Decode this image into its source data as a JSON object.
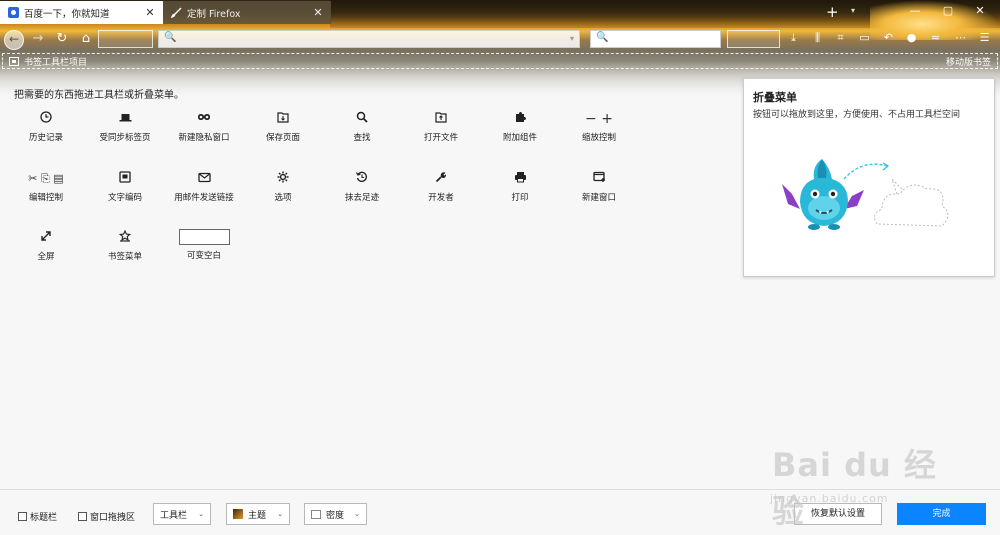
{
  "tabs": [
    {
      "title": "百度一下，你就知道",
      "icon": "baidu-paw-icon"
    },
    {
      "title": "定制 Firefox",
      "icon": "paintbrush-icon"
    }
  ],
  "tab_close_glyph": "✕",
  "new_tab_glyph": "+",
  "tab_list_glyph": "▾",
  "window_controls": {
    "minimize": "—",
    "maximize": "▢",
    "close": "✕"
  },
  "nav": {
    "back": "←",
    "forward": "→",
    "reload": "↻",
    "home": "⌂",
    "url_dropdown": "▾",
    "search_glyph": "🔍"
  },
  "toolbar_icons": [
    "⤓",
    "⫼",
    "⌗",
    "▭",
    "↶",
    "●",
    "≈",
    "⋯",
    "☰"
  ],
  "bookmarks_bar": {
    "left_label": "书签工具栏项目",
    "right_label": "移动版书签"
  },
  "customize": {
    "hint": "把需要的东西拖进工具栏或折叠菜单。",
    "items": [
      {
        "label": "历史记录",
        "icon": "history-clock-icon",
        "glyph": "🕓"
      },
      {
        "label": "受同步标签页",
        "icon": "synced-tabs-icon",
        "glyph": "▬"
      },
      {
        "label": "新建隐私窗口",
        "icon": "private-mask-icon",
        "glyph": "∞"
      },
      {
        "label": "保存页面",
        "icon": "save-page-icon",
        "glyph": "▣"
      },
      {
        "label": "查找",
        "icon": "find-magnifier-icon",
        "glyph": "⌕"
      },
      {
        "label": "打开文件",
        "icon": "open-file-icon",
        "glyph": "▤"
      },
      {
        "label": "附加组件",
        "icon": "addons-puzzle-icon",
        "glyph": "✚"
      },
      {
        "label": "缩放控制",
        "icon": "zoom-controls-icon",
        "glyph": "− +"
      },
      {
        "label": "编辑控制",
        "icon": "edit-controls-icon",
        "glyph": "✂ ⎘ ▤"
      },
      {
        "label": "文字编码",
        "icon": "text-encoding-icon",
        "glyph": "▣"
      },
      {
        "label": "用邮件发送链接",
        "icon": "email-link-icon",
        "glyph": "✉"
      },
      {
        "label": "选项",
        "icon": "options-gear-icon",
        "glyph": "✲"
      },
      {
        "label": "抹去足迹",
        "icon": "forget-history-icon",
        "glyph": "↺"
      },
      {
        "label": "开发者",
        "icon": "developer-wrench-icon",
        "glyph": "🔧"
      },
      {
        "label": "打印",
        "icon": "print-icon",
        "glyph": "⎙"
      },
      {
        "label": "新建窗口",
        "icon": "new-window-icon",
        "glyph": "▭"
      },
      {
        "label": "全屏",
        "icon": "fullscreen-icon",
        "glyph": "⤢"
      },
      {
        "label": "书签菜单",
        "icon": "bookmarks-menu-icon",
        "glyph": "☆"
      },
      {
        "label": "可变空白",
        "icon": "flexible-space-icon",
        "glyph": ""
      }
    ]
  },
  "overflow_panel": {
    "title": "折叠菜单",
    "description": "按钮可以拖放到这里，方便使用、不占用工具栏空间"
  },
  "bottom": {
    "titlebar_label": "标题栏",
    "dragspace_label": "窗口拖拽区",
    "toolbars_label": "工具栏",
    "theme_label": "主题",
    "density_label": "密度",
    "caret": "⌄",
    "restore_label": "恢复默认设置",
    "done_label": "完成"
  },
  "watermark": {
    "main": "Bai  du 经验",
    "sub": "jingyan.baidu.com"
  },
  "colors": {
    "accent": "#0a84ff",
    "background": "#f7f7f8",
    "sunset": "#f0b73a"
  }
}
